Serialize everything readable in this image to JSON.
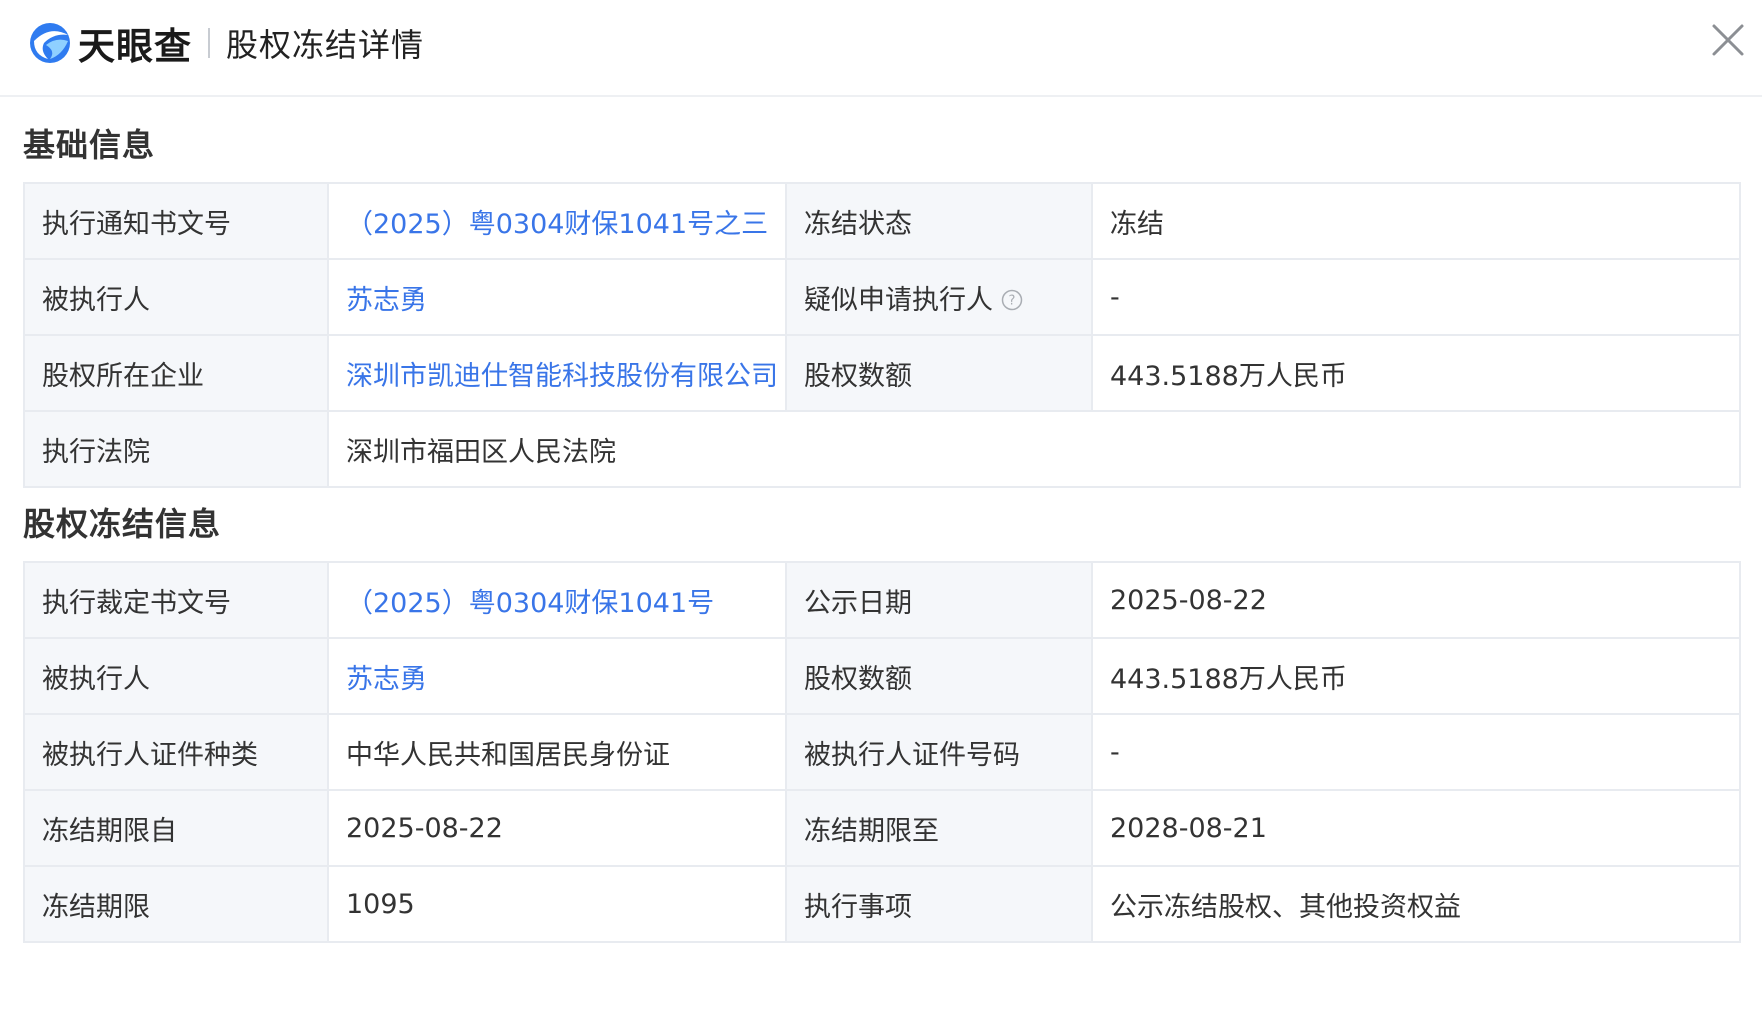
{
  "header": {
    "logo_text": "天眼查",
    "title": "股权冻结详情",
    "brand_color": "#2f7bf0"
  },
  "basic": {
    "section_title": "基础信息",
    "rows": [
      [
        {
          "label": "执行通知书文号",
          "value": "（2025）粤0304财保1041号之三",
          "link": true
        },
        {
          "label": "冻结状态",
          "value": "冻结",
          "link": false
        }
      ],
      [
        {
          "label": "被执行人",
          "value": "苏志勇",
          "link": true
        },
        {
          "label": "疑似申请执行人",
          "value": "-",
          "link": false
        }
      ],
      [
        {
          "label": "股权所在企业",
          "value": "深圳市凯迪仕智能科技股份有限公司",
          "link": true
        },
        {
          "label": "股权数额",
          "value": "443.5188万人民币",
          "link": false
        }
      ],
      [
        {
          "label": "执行法院",
          "value": "深圳市福田区人民法院",
          "link": false
        }
      ]
    ]
  },
  "freeze": {
    "section_title": "股权冻结信息",
    "rows": [
      [
        {
          "label": "执行裁定书文号",
          "value": "（2025）粤0304财保1041号",
          "link": true
        },
        {
          "label": "公示日期",
          "value": "2025-08-22",
          "link": false
        }
      ],
      [
        {
          "label": "被执行人",
          "value": "苏志勇",
          "link": true
        },
        {
          "label": "股权数额",
          "value": "443.5188万人民币",
          "link": false
        }
      ],
      [
        {
          "label": "被执行人证件种类",
          "value": "中华人民共和国居民身份证",
          "link": false
        },
        {
          "label": "被执行人证件号码",
          "value": "-",
          "link": false
        }
      ],
      [
        {
          "label": "冻结期限自",
          "value": "2025-08-22",
          "link": false
        },
        {
          "label": "冻结期限至",
          "value": "2028-08-21",
          "link": false
        }
      ],
      [
        {
          "label": "冻结期限",
          "value": "1095",
          "link": false
        },
        {
          "label": "执行事项",
          "value": "公示冻结股权、其他投资权益",
          "link": false
        }
      ]
    ]
  },
  "colors": {
    "link": "#3975e8",
    "label_bg": "#f5f7fa",
    "border": "#e8ebf0"
  },
  "icons": {
    "close": "close-icon",
    "help": "question-circle-icon",
    "logo": "tianyancha-logo-icon"
  }
}
